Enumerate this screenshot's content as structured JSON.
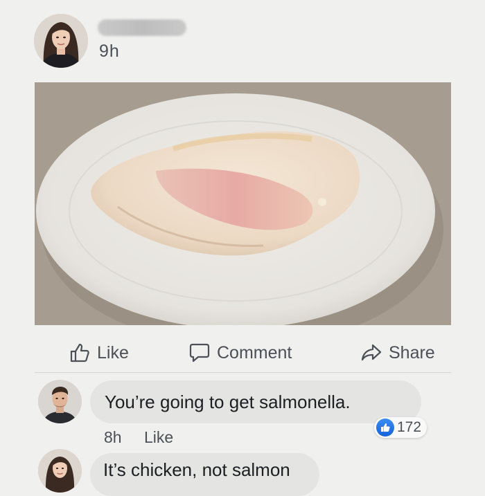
{
  "post": {
    "author_name": "",
    "time": "9h",
    "photo_alt": "",
    "actions": {
      "like": "Like",
      "comment": "Comment",
      "share": "Share"
    }
  },
  "comments": [
    {
      "text": "You’re going to get salmonella.",
      "time": "8h",
      "like_label": "Like",
      "reaction_count": "172"
    },
    {
      "text": "It’s chicken, not salmon"
    }
  ],
  "icons": {
    "like": "thumbs-up-outline-icon",
    "comment": "speech-bubble-icon",
    "share": "share-arrow-icon",
    "reaction": "thumbs-up-filled-icon"
  },
  "colors": {
    "background": "#f0f0ef",
    "bubble": "#e4e4e3",
    "secondary_text": "#4b4f56",
    "like_blue": "#1877f2"
  }
}
